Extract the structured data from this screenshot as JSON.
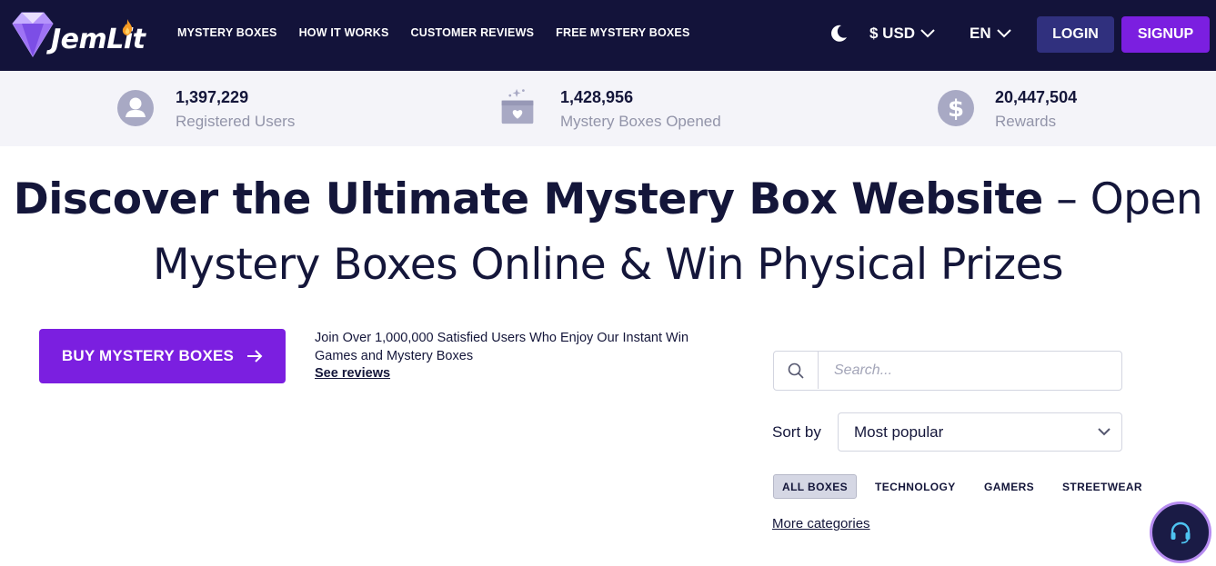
{
  "brand": {
    "name": "JemLit"
  },
  "nav": {
    "links": [
      "MYSTERY BOXES",
      "HOW IT WORKS",
      "CUSTOMER REVIEWS",
      "FREE MYSTERY BOXES"
    ],
    "currency": "$ USD",
    "language": "EN",
    "login_label": "LOGIN",
    "signup_label": "SIGNUP"
  },
  "stats": [
    {
      "value": "1,397,229",
      "label": "Registered Users",
      "icon": "user-icon"
    },
    {
      "value": "1,428,956",
      "label": "Mystery Boxes Opened",
      "icon": "gift-box-icon"
    },
    {
      "value": "20,447,504",
      "label": "Rewards",
      "icon": "dollar-icon"
    }
  ],
  "hero": {
    "title_bold": "Discover the Ultimate Mystery Box Website",
    "title_light_1": " – Open",
    "title_light_2": "Mystery Boxes Online & Win Physical Prizes"
  },
  "cta": {
    "buy_label": "BUY MYSTERY BOXES",
    "join_text": "Join Over 1,000,000 Satisfied Users Who Enjoy Our Instant Win Games and Mystery Boxes",
    "see_reviews": "See reviews"
  },
  "filters": {
    "search_placeholder": "Search...",
    "sort_label": "Sort by",
    "sort_value": "Most popular",
    "categories": [
      "ALL BOXES",
      "TECHNOLOGY",
      "GAMERS",
      "STREETWEAR"
    ],
    "active_category": "ALL BOXES",
    "more_categories": "More categories"
  },
  "colors": {
    "navbar": "#13133a",
    "accent_purple": "#7b1fe0",
    "login_blue": "#30307e",
    "stats_bg": "#f4f4f9",
    "text_dark": "#14163a",
    "text_muted": "#9294a9"
  }
}
